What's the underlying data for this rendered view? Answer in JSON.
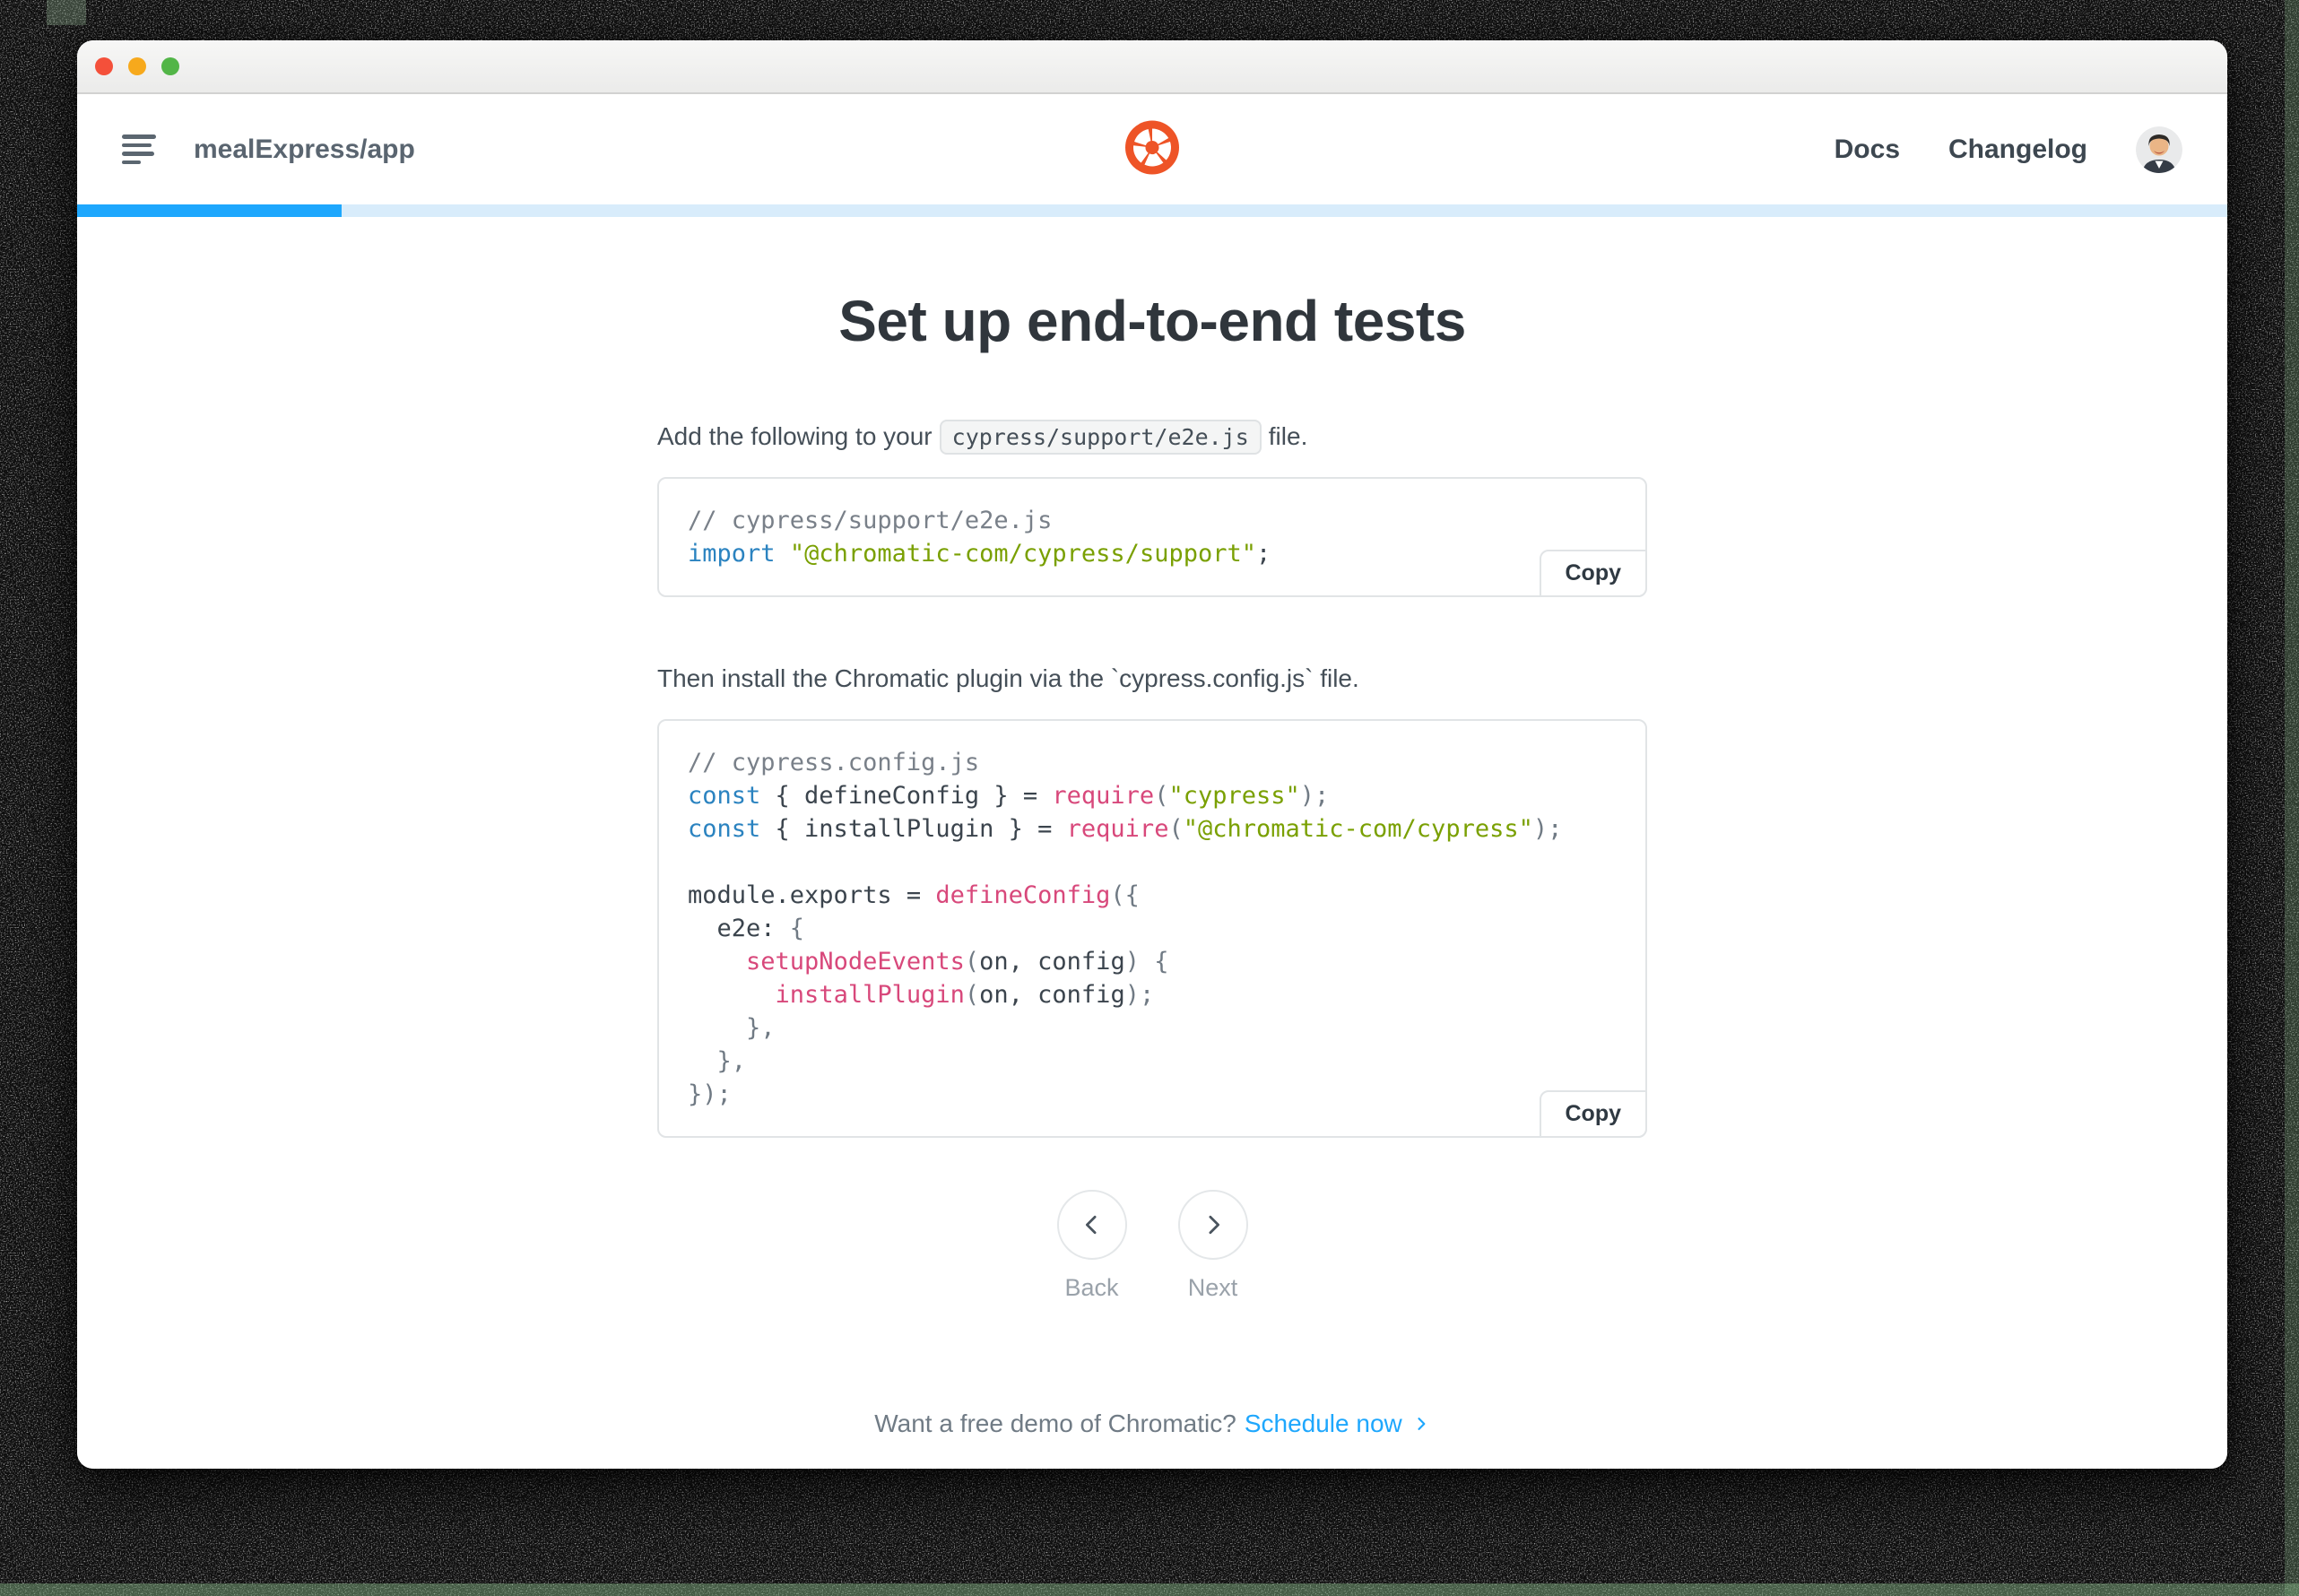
{
  "titlebar": {
    "lights": {
      "close": "#f4503a",
      "minimize": "#f7a91c",
      "zoom": "#52b547"
    }
  },
  "header": {
    "project_name": "mealExpress/app",
    "nav": [
      {
        "label": "Docs"
      },
      {
        "label": "Changelog"
      }
    ],
    "logo_color": "#ee5427"
  },
  "progress": {
    "percent": 12.3,
    "fill_color": "#1ea7fd",
    "track_color": "#d8ecfb"
  },
  "content": {
    "heading": "Set up end-to-end tests",
    "instruction_1": {
      "before": "Add the following to your",
      "code": "cypress/support/e2e.js",
      "after": "file."
    },
    "code_block_1": {
      "copy_label": "Copy",
      "lines": [
        [
          [
            "c",
            "// cypress/support/e2e.js"
          ]
        ],
        [
          [
            "k",
            "import"
          ],
          [
            "t",
            " "
          ],
          [
            "s",
            "\"@chromatic-com/cypress/support\""
          ],
          [
            "t",
            ";"
          ]
        ]
      ]
    },
    "instruction_2": "Then install the Chromatic plugin via the `cypress.config.js` file.",
    "code_block_2": {
      "copy_label": "Copy",
      "lines": [
        [
          [
            "c",
            "// cypress.config.js"
          ]
        ],
        [
          [
            "k",
            "const"
          ],
          [
            "t",
            " { defineConfig } = "
          ],
          [
            "f",
            "require"
          ],
          [
            "p",
            "("
          ],
          [
            "s",
            "\"cypress\""
          ],
          [
            "p",
            ");"
          ]
        ],
        [
          [
            "k",
            "const"
          ],
          [
            "t",
            " { installPlugin } = "
          ],
          [
            "f",
            "require"
          ],
          [
            "p",
            "("
          ],
          [
            "s",
            "\"@chromatic-com/cypress\""
          ],
          [
            "p",
            ");"
          ]
        ],
        [],
        [
          [
            "t",
            "module.exports = "
          ],
          [
            "f",
            "defineConfig"
          ],
          [
            "p",
            "({"
          ]
        ],
        [
          [
            "t",
            "  e2e: "
          ],
          [
            "p",
            "{"
          ]
        ],
        [
          [
            "t",
            "    "
          ],
          [
            "f",
            "setupNodeEvents"
          ],
          [
            "p",
            "("
          ],
          [
            "t",
            "on, config"
          ],
          [
            "p",
            ") {"
          ]
        ],
        [
          [
            "t",
            "      "
          ],
          [
            "f",
            "installPlugin"
          ],
          [
            "p",
            "("
          ],
          [
            "t",
            "on, config"
          ],
          [
            "p",
            ");"
          ]
        ],
        [
          [
            "p",
            "    },"
          ]
        ],
        [
          [
            "p",
            "  },"
          ]
        ],
        [
          [
            "p",
            "});"
          ]
        ]
      ]
    },
    "pager": {
      "back": "Back",
      "next": "Next"
    },
    "footer": {
      "prompt": "Want a free demo of Chromatic?",
      "link": "Schedule now"
    }
  },
  "syntax_colors": {
    "comment": "#798089",
    "keyword": "#2b83c0",
    "string": "#7aa002",
    "function": "#d8487b",
    "punctuation": "#707a84",
    "plain": "#3b444d"
  }
}
